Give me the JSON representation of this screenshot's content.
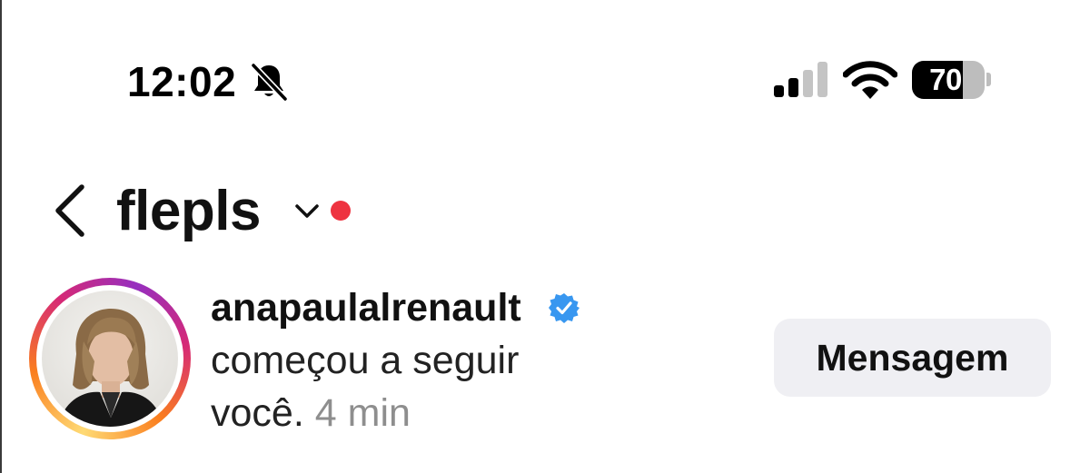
{
  "status_bar": {
    "time": "12:02",
    "silent_icon": "bell-slash-icon",
    "signal_icon": "cellular-signal-icon",
    "signal_bars_active": 2,
    "signal_bars_total": 4,
    "wifi_icon": "wifi-icon",
    "battery_icon": "battery-icon",
    "battery_percent": "70",
    "battery_level": 0.7
  },
  "header": {
    "back_icon": "chevron-left-icon",
    "title": "flepls",
    "dropdown_icon": "chevron-down-icon",
    "unread_dot_color": "#ee3340"
  },
  "notification": {
    "avatar_icon": "profile-photo",
    "story_ring_colors": [
      "#feda75",
      "#fa7e1e",
      "#d62976",
      "#962fbf"
    ],
    "username": "anapaulalrenault",
    "verified_icon": "verified-badge-icon",
    "verified_color": "#3897f0",
    "text_line1": "começou a seguir",
    "text_line2": "você.",
    "time": "4 min",
    "action_button": "Mensagem"
  }
}
